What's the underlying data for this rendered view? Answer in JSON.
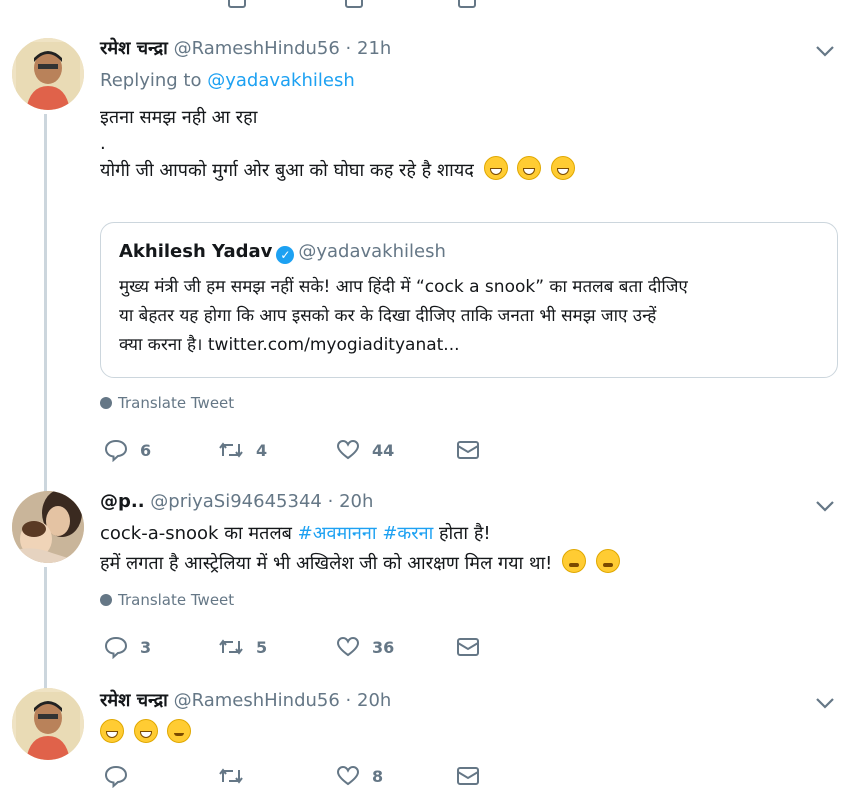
{
  "tweets": [
    {
      "name": "रमेश चन्द्रा",
      "handle": "@RameshHindu56",
      "dot": "·",
      "time": "21h",
      "reply_prefix": "Replying to",
      "reply_to": "@yadavakhilesh",
      "line1": "इतना समझ नही आ रहा",
      "line2": ".",
      "line3": "योगी जी आपको मुर्गा ओर बुआ को घोघा कह रहे है शायद",
      "quote": {
        "name": "Akhilesh Yadav",
        "handle": "@yadavakhilesh",
        "line1": "मुख्य मंत्री जी हम समझ नहीं सके! आप हिंदी में “cock a snook” का मतलब बता दीजिए",
        "line2": "या बेहतर यह होगा कि आप इसको कर के दिखा दीजिए ताकि जनता भी समझ जाए उन्हें",
        "line3": "क्या करना है। twitter.com/myogiadityanat..."
      },
      "translate": "Translate Tweet",
      "replies": "6",
      "retweets": "4",
      "likes": "44"
    },
    {
      "name": "@p..",
      "handle": "@priyaSi94645344",
      "dot": "·",
      "time": "20h",
      "line1_a": "cock-a-snook का मतलब ",
      "tag1": "#अवमानना",
      "space": " ",
      "tag2": "#करना",
      "line1_b": " होता है!",
      "line2": "हमें लगता है आस्ट्रेलिया में भी अखिलेश जी को आरक्षण मिल गया था!",
      "translate": "Translate Tweet",
      "replies": "3",
      "retweets": "5",
      "likes": "36"
    },
    {
      "name": "रमेश चन्द्रा",
      "handle": "@RameshHindu56",
      "dot": "·",
      "time": "20h",
      "replies": "",
      "retweets": "",
      "likes": "8"
    }
  ],
  "icons": {
    "reply": "reply-icon",
    "retweet": "retweet-icon",
    "like": "heart-icon",
    "dm": "envelope-icon",
    "more": "chevron-down-icon",
    "verified": "verified-badge-icon",
    "translate": "globe-icon"
  },
  "colors": {
    "text": "#14171a",
    "secondary": "#657786",
    "link": "#1da1f2",
    "border": "#ccd6dd"
  }
}
